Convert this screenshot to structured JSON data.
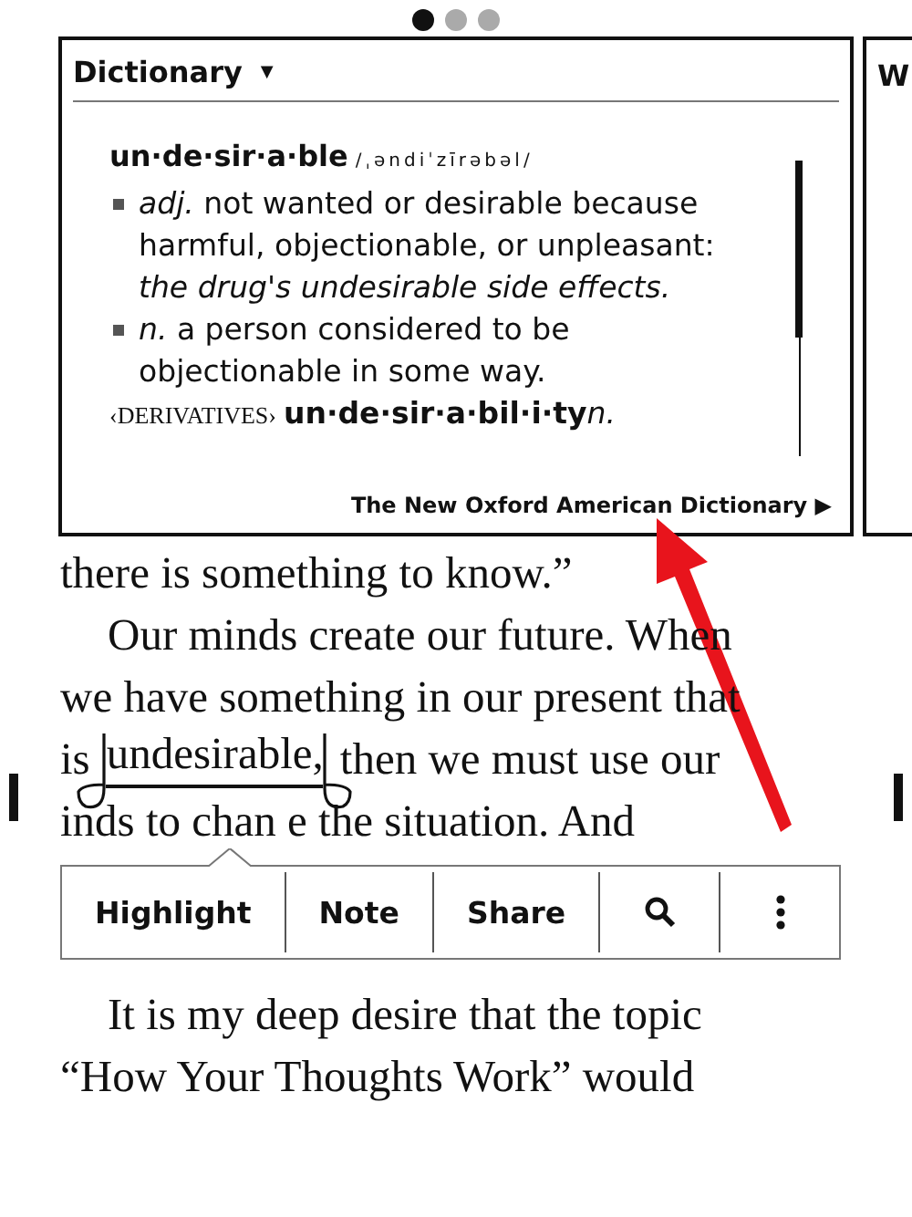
{
  "page_dots": [
    {
      "selected": true
    },
    {
      "selected": false
    },
    {
      "selected": false
    }
  ],
  "dictionary": {
    "title": "Dictionary",
    "caret": "▼",
    "headword": "un·de·sir·a·ble",
    "pronunciation": "/ˌəndiˈzīrəbəl/",
    "senses": [
      {
        "pos": "adj.",
        "definition": "not wanted or desirable because harmful, objectionable, or unpleasant: ",
        "example": "the drug's undesirable side effects."
      },
      {
        "pos": "n.",
        "definition": "a person considered to be objectionable in some way."
      }
    ],
    "derivatives_label": "‹DERIVATIVES›",
    "derivative": "un·de·sir·a·bil·i·ty",
    "derivative_pos": "n.",
    "source": "The New Oxford American Dictionary",
    "source_arrow": "▶"
  },
  "next_card": {
    "title": "W"
  },
  "book_lines": [
    {
      "kind": "plain",
      "text": "there is something to know.”",
      "indent": false
    },
    {
      "kind": "plain",
      "text": "Our minds create our future. When",
      "indent": true
    },
    {
      "kind": "plain",
      "text": "we have something in our present that",
      "indent": false
    },
    {
      "kind": "selection",
      "before": "is",
      "selected": "undesirable,",
      "after": "then we must use our",
      "indent": false
    },
    {
      "kind": "plain",
      "text": "inds to chan e the situation. And",
      "indent": false
    },
    {
      "kind": "gap"
    },
    {
      "kind": "plain",
      "text": "It is my deep desire that the topic",
      "indent": true
    },
    {
      "kind": "plain",
      "text": "“How Your Thoughts Work” would",
      "indent": false
    }
  ],
  "toolbar": [
    {
      "kind": "text",
      "label": "Highlight"
    },
    {
      "kind": "text",
      "label": "Note"
    },
    {
      "kind": "text",
      "label": "Share"
    },
    {
      "kind": "search"
    },
    {
      "kind": "more"
    }
  ]
}
